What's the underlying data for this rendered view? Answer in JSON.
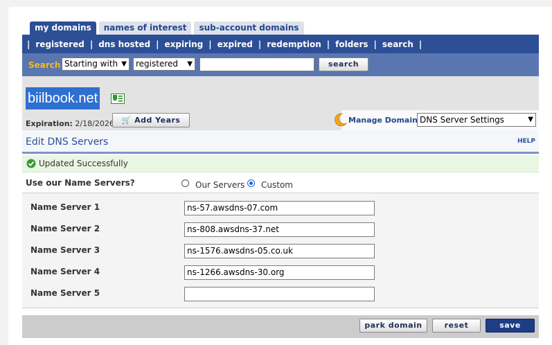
{
  "tabs": [
    {
      "label": "my domains",
      "active": true
    },
    {
      "label": "names of interest",
      "active": false
    },
    {
      "label": "sub-account domains",
      "active": false
    }
  ],
  "subnav": [
    "registered",
    "dns hosted",
    "expiring",
    "expired",
    "redemption",
    "folders",
    "search"
  ],
  "search": {
    "label": "Search",
    "match_select": "Starting with",
    "scope_select": "registered",
    "query": "",
    "button": "search"
  },
  "domain": {
    "name": "biilbook.net",
    "expiration_label": "Expiration:",
    "expiration_date": "2/18/2026",
    "add_years_button": "Add Years",
    "manage_label": "Manage Domain:",
    "manage_select": "DNS Server Settings"
  },
  "section": {
    "title": "Edit DNS Servers",
    "help": "HELP"
  },
  "status": {
    "message": "Updated Successfully"
  },
  "nameserver_choice": {
    "question": "Use our Name Servers?",
    "our_label": "Our Servers",
    "custom_label": "Custom",
    "selected": "Custom"
  },
  "name_servers": [
    {
      "label": "Name Server 1",
      "value": "ns-57.awsdns-07.com"
    },
    {
      "label": "Name Server 2",
      "value": "ns-808.awsdns-37.net"
    },
    {
      "label": "Name Server 3",
      "value": "ns-1576.awsdns-05.co.uk"
    },
    {
      "label": "Name Server 4",
      "value": "ns-1266.awsdns-30.org"
    },
    {
      "label": "Name Server 5",
      "value": ""
    }
  ],
  "actions": {
    "park": "park domain",
    "reset": "reset",
    "save": "save"
  },
  "colors": {
    "nav_blue": "#2c4f96",
    "search_bar": "#5a76b1",
    "search_label": "#f6b91a",
    "success_bg": "#e9f6e3"
  }
}
